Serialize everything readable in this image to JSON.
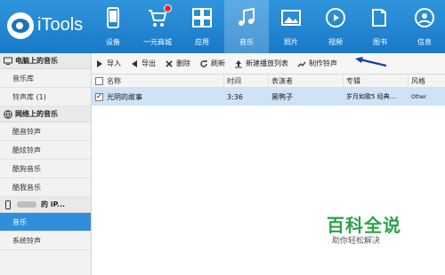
{
  "app": {
    "name": "iTools"
  },
  "nav": [
    {
      "label": "设备",
      "icon": "phone-icon"
    },
    {
      "label": "一元商城",
      "icon": "cart-icon"
    },
    {
      "label": "应用",
      "icon": "apps-icon"
    },
    {
      "label": "音乐",
      "icon": "music-icon",
      "active": true
    },
    {
      "label": "照片",
      "icon": "photo-icon"
    },
    {
      "label": "视频",
      "icon": "video-icon"
    },
    {
      "label": "图书",
      "icon": "book-icon"
    },
    {
      "label": "信息",
      "icon": "user-icon"
    }
  ],
  "sidebar": {
    "computer": {
      "header": "电脑上的音乐",
      "items": [
        "音乐库",
        "铃声库 (1)"
      ]
    },
    "online": {
      "header": "网络上的音乐",
      "items": [
        "酷音铃声",
        "酷炫铃声",
        "酷狗音乐",
        "酷我音乐"
      ]
    },
    "device": {
      "header_suffix": "的 iP...",
      "items": [
        "音乐",
        "系统铃声"
      ]
    }
  },
  "toolbar": {
    "import": "导入",
    "export": "导出",
    "delete": "删除",
    "refresh": "刷新",
    "new_playlist": "新建播放列表",
    "make_ringtone": "制作铃声"
  },
  "table": {
    "columns": [
      "名称",
      "时间",
      "表演者",
      "专辑",
      "风格"
    ],
    "rows": [
      {
        "checked": "✓",
        "name": "光阴的故事",
        "time": "3:36",
        "artist": "黑鸭子",
        "album": "岁月如歌5 经典...",
        "genre": "Other"
      }
    ]
  },
  "watermark": {
    "title": "百科全说",
    "subtitle": "助你轻松解决"
  },
  "colors": {
    "accent": "#1f84d2",
    "selected_row": "#cfe3f7",
    "annotation_arrow": "#1a3fa8",
    "brand_green": "#2ca24a"
  }
}
